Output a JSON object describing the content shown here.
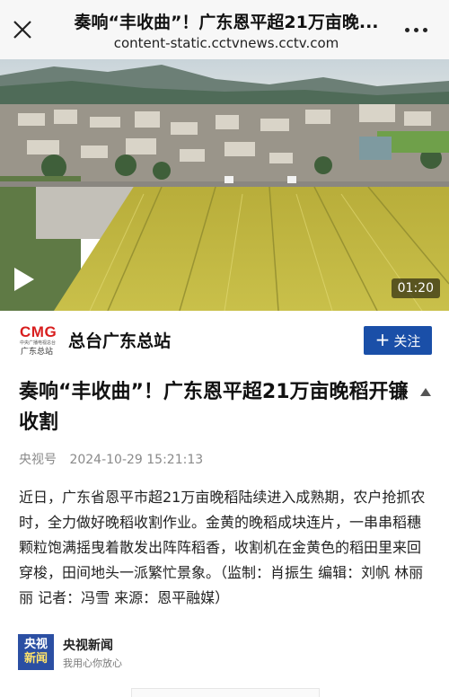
{
  "topbar": {
    "title": "奏响“丰收曲”！广东恩平超21万亩晚...",
    "url": "content-static.cctvnews.cctv.com",
    "close_icon": "close-icon",
    "more_icon": "more-dots-icon"
  },
  "video": {
    "duration": "01:20",
    "play_icon": "play-icon"
  },
  "account": {
    "logo_text": "CMG",
    "logo_tiny": "中央广播电视总台",
    "logo_sub": "广东总站",
    "name": "总台广东总站",
    "follow_label": "关注",
    "follow_color": "#1a4fa8"
  },
  "article": {
    "headline": "奏响“丰收曲”！广东恩平超21万亩晚稻开镰收割",
    "source": "央视号",
    "datetime": "2024-10-29 15:21:13",
    "body": "近日，广东省恩平市超21万亩晚稻陆续进入成熟期，农户抢抓农时，全力做好晚稻收割作业。金黄的晚稻成块连片，一串串稻穗颗粒饱满摇曳着散发出阵阵稻香，收割机在金黄色的稻田里来回穿梭，田间地头一派繁忙景象。（监制：肖振生 编辑：刘帆 林丽丽 记者：冯雪 来源：恩平融媒）"
  },
  "footer": {
    "logo_line1": "央视",
    "logo_line2": "新闻",
    "name": "央视新闻",
    "slogan": "我用心你放心"
  }
}
